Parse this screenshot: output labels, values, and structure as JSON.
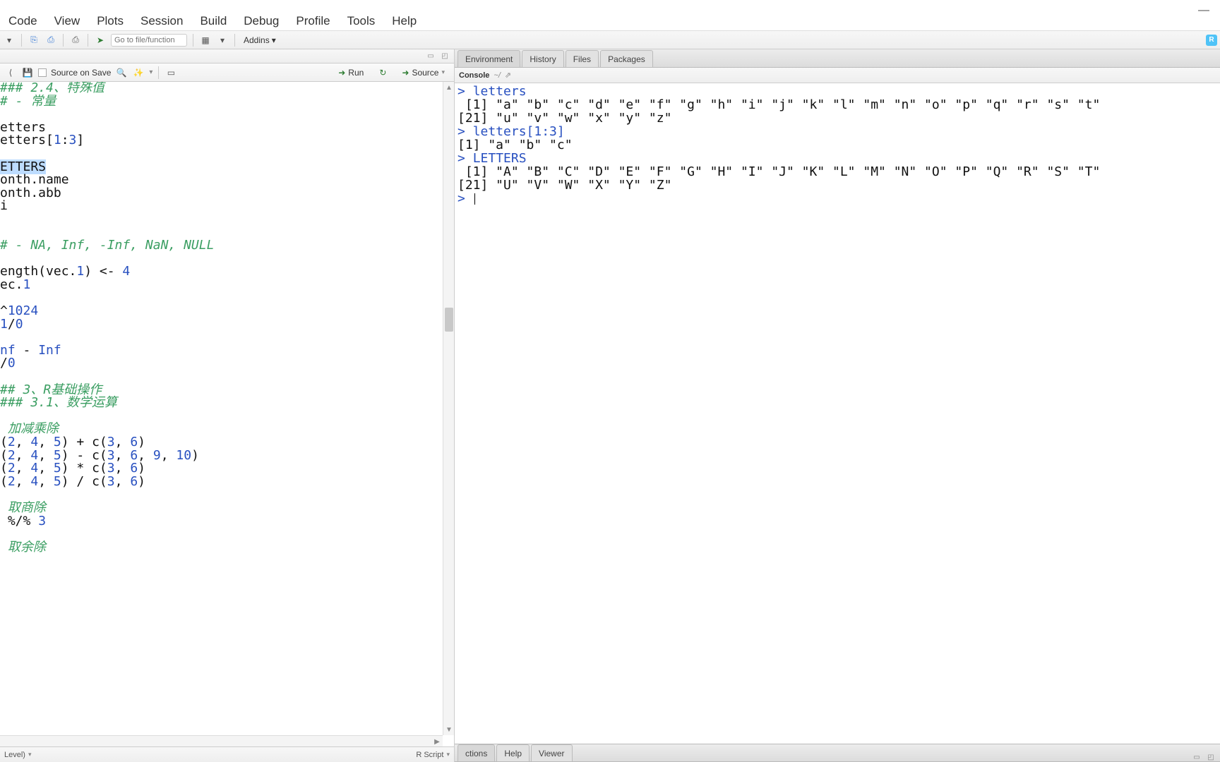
{
  "menu": [
    "Code",
    "View",
    "Plots",
    "Session",
    "Build",
    "Debug",
    "Profile",
    "Tools",
    "Help"
  ],
  "toolbar": {
    "goto_placeholder": "Go to file/function",
    "addins": "Addins"
  },
  "source_toolbar": {
    "source_on_save": "Source on Save",
    "run": "Run",
    "source": "Source"
  },
  "status": {
    "left": "Level)",
    "right": "R Script"
  },
  "right_tabs": [
    "Environment",
    "History",
    "Files",
    "Packages"
  ],
  "console_header": {
    "title": "Console",
    "path": "~/"
  },
  "console_lines": [
    {
      "type": "cmd",
      "prompt": "> ",
      "text": "letters"
    },
    {
      "type": "out",
      "text": " [1] \"a\" \"b\" \"c\" \"d\" \"e\" \"f\" \"g\" \"h\" \"i\" \"j\" \"k\" \"l\" \"m\" \"n\" \"o\" \"p\" \"q\" \"r\" \"s\" \"t\""
    },
    {
      "type": "out",
      "text": "[21] \"u\" \"v\" \"w\" \"x\" \"y\" \"z\""
    },
    {
      "type": "cmd",
      "prompt": "> ",
      "text": "letters[1:3]"
    },
    {
      "type": "out",
      "text": "[1] \"a\" \"b\" \"c\""
    },
    {
      "type": "cmd",
      "prompt": "> ",
      "text": "LETTERS"
    },
    {
      "type": "out",
      "text": " [1] \"A\" \"B\" \"C\" \"D\" \"E\" \"F\" \"G\" \"H\" \"I\" \"J\" \"K\" \"L\" \"M\" \"N\" \"O\" \"P\" \"Q\" \"R\" \"S\" \"T\""
    },
    {
      "type": "out",
      "text": "[21] \"U\" \"V\" \"W\" \"X\" \"Y\" \"Z\""
    },
    {
      "type": "prompt",
      "prompt": "> ",
      "text": ""
    }
  ],
  "bottom_tabs": [
    "ctions",
    "Help",
    "Viewer"
  ],
  "editor_lines": [
    {
      "segments": [
        {
          "t": "### 2.4、特殊值",
          "cls": "c-comment"
        }
      ]
    },
    {
      "segments": [
        {
          "t": "# - 常量",
          "cls": "c-comment"
        }
      ]
    },
    {
      "segments": [
        {
          "t": "",
          "cls": ""
        }
      ]
    },
    {
      "segments": [
        {
          "t": "etters",
          "cls": "c-ident"
        }
      ]
    },
    {
      "segments": [
        {
          "t": "etters[",
          "cls": "c-ident"
        },
        {
          "t": "1",
          "cls": "c-num"
        },
        {
          "t": ":",
          "cls": "c-op"
        },
        {
          "t": "3",
          "cls": "c-num"
        },
        {
          "t": "]",
          "cls": "c-ident"
        }
      ]
    },
    {
      "segments": [
        {
          "t": "",
          "cls": ""
        }
      ]
    },
    {
      "segments": [
        {
          "t": "ETTERS",
          "cls": "c-ident sel"
        }
      ]
    },
    {
      "segments": [
        {
          "t": "onth.name",
          "cls": "c-ident"
        }
      ]
    },
    {
      "segments": [
        {
          "t": "onth.abb",
          "cls": "c-ident"
        }
      ]
    },
    {
      "segments": [
        {
          "t": "i",
          "cls": "c-ident"
        }
      ]
    },
    {
      "segments": [
        {
          "t": "",
          "cls": ""
        }
      ]
    },
    {
      "segments": [
        {
          "t": "",
          "cls": ""
        }
      ]
    },
    {
      "segments": [
        {
          "t": "# - NA, Inf, -Inf, NaN, NULL",
          "cls": "c-comment"
        }
      ]
    },
    {
      "segments": [
        {
          "t": "",
          "cls": ""
        }
      ]
    },
    {
      "segments": [
        {
          "t": "ength(vec.",
          "cls": "c-ident"
        },
        {
          "t": "1",
          "cls": "c-num"
        },
        {
          "t": ") <- ",
          "cls": "c-op"
        },
        {
          "t": "4",
          "cls": "c-num"
        }
      ]
    },
    {
      "segments": [
        {
          "t": "ec.",
          "cls": "c-ident"
        },
        {
          "t": "1",
          "cls": "c-num"
        }
      ]
    },
    {
      "segments": [
        {
          "t": "",
          "cls": ""
        }
      ]
    },
    {
      "segments": [
        {
          "t": "^",
          "cls": "c-op"
        },
        {
          "t": "1024",
          "cls": "c-num"
        }
      ]
    },
    {
      "segments": [
        {
          "t": "1",
          "cls": "c-num"
        },
        {
          "t": "/",
          "cls": "c-op"
        },
        {
          "t": "0",
          "cls": "c-num"
        }
      ]
    },
    {
      "segments": [
        {
          "t": "",
          "cls": ""
        }
      ]
    },
    {
      "segments": [
        {
          "t": "nf",
          "cls": "c-const"
        },
        {
          "t": " - ",
          "cls": "c-op"
        },
        {
          "t": "Inf",
          "cls": "c-const"
        }
      ]
    },
    {
      "segments": [
        {
          "t": "/",
          "cls": "c-op"
        },
        {
          "t": "0",
          "cls": "c-num"
        }
      ]
    },
    {
      "segments": [
        {
          "t": "",
          "cls": ""
        }
      ]
    },
    {
      "segments": [
        {
          "t": "## 3、R基础操作",
          "cls": "c-comment"
        }
      ]
    },
    {
      "segments": [
        {
          "t": "### 3.1、数学运算",
          "cls": "c-comment"
        }
      ]
    },
    {
      "segments": [
        {
          "t": "",
          "cls": ""
        }
      ]
    },
    {
      "segments": [
        {
          "t": " 加减乘除",
          "cls": "c-comment"
        }
      ]
    },
    {
      "segments": [
        {
          "t": "(",
          "cls": "c-ident"
        },
        {
          "t": "2",
          "cls": "c-num"
        },
        {
          "t": ", ",
          "cls": "c-op"
        },
        {
          "t": "4",
          "cls": "c-num"
        },
        {
          "t": ", ",
          "cls": "c-op"
        },
        {
          "t": "5",
          "cls": "c-num"
        },
        {
          "t": ") + c(",
          "cls": "c-ident"
        },
        {
          "t": "3",
          "cls": "c-num"
        },
        {
          "t": ", ",
          "cls": "c-op"
        },
        {
          "t": "6",
          "cls": "c-num"
        },
        {
          "t": ")",
          "cls": "c-ident"
        }
      ]
    },
    {
      "segments": [
        {
          "t": "(",
          "cls": "c-ident"
        },
        {
          "t": "2",
          "cls": "c-num"
        },
        {
          "t": ", ",
          "cls": "c-op"
        },
        {
          "t": "4",
          "cls": "c-num"
        },
        {
          "t": ", ",
          "cls": "c-op"
        },
        {
          "t": "5",
          "cls": "c-num"
        },
        {
          "t": ") - c(",
          "cls": "c-ident"
        },
        {
          "t": "3",
          "cls": "c-num"
        },
        {
          "t": ", ",
          "cls": "c-op"
        },
        {
          "t": "6",
          "cls": "c-num"
        },
        {
          "t": ", ",
          "cls": "c-op"
        },
        {
          "t": "9",
          "cls": "c-num"
        },
        {
          "t": ", ",
          "cls": "c-op"
        },
        {
          "t": "10",
          "cls": "c-num"
        },
        {
          "t": ")",
          "cls": "c-ident"
        }
      ]
    },
    {
      "segments": [
        {
          "t": "(",
          "cls": "c-ident"
        },
        {
          "t": "2",
          "cls": "c-num"
        },
        {
          "t": ", ",
          "cls": "c-op"
        },
        {
          "t": "4",
          "cls": "c-num"
        },
        {
          "t": ", ",
          "cls": "c-op"
        },
        {
          "t": "5",
          "cls": "c-num"
        },
        {
          "t": ") * c(",
          "cls": "c-ident"
        },
        {
          "t": "3",
          "cls": "c-num"
        },
        {
          "t": ", ",
          "cls": "c-op"
        },
        {
          "t": "6",
          "cls": "c-num"
        },
        {
          "t": ")",
          "cls": "c-ident"
        }
      ]
    },
    {
      "segments": [
        {
          "t": "(",
          "cls": "c-ident"
        },
        {
          "t": "2",
          "cls": "c-num"
        },
        {
          "t": ", ",
          "cls": "c-op"
        },
        {
          "t": "4",
          "cls": "c-num"
        },
        {
          "t": ", ",
          "cls": "c-op"
        },
        {
          "t": "5",
          "cls": "c-num"
        },
        {
          "t": ") / c(",
          "cls": "c-ident"
        },
        {
          "t": "3",
          "cls": "c-num"
        },
        {
          "t": ", ",
          "cls": "c-op"
        },
        {
          "t": "6",
          "cls": "c-num"
        },
        {
          "t": ")",
          "cls": "c-ident"
        }
      ]
    },
    {
      "segments": [
        {
          "t": "",
          "cls": ""
        }
      ]
    },
    {
      "segments": [
        {
          "t": " 取商除",
          "cls": "c-comment"
        }
      ]
    },
    {
      "segments": [
        {
          "t": " %/% ",
          "cls": "c-op"
        },
        {
          "t": "3",
          "cls": "c-num"
        }
      ]
    },
    {
      "segments": [
        {
          "t": "",
          "cls": ""
        }
      ]
    },
    {
      "segments": [
        {
          "t": " 取余除",
          "cls": "c-comment"
        }
      ]
    }
  ]
}
